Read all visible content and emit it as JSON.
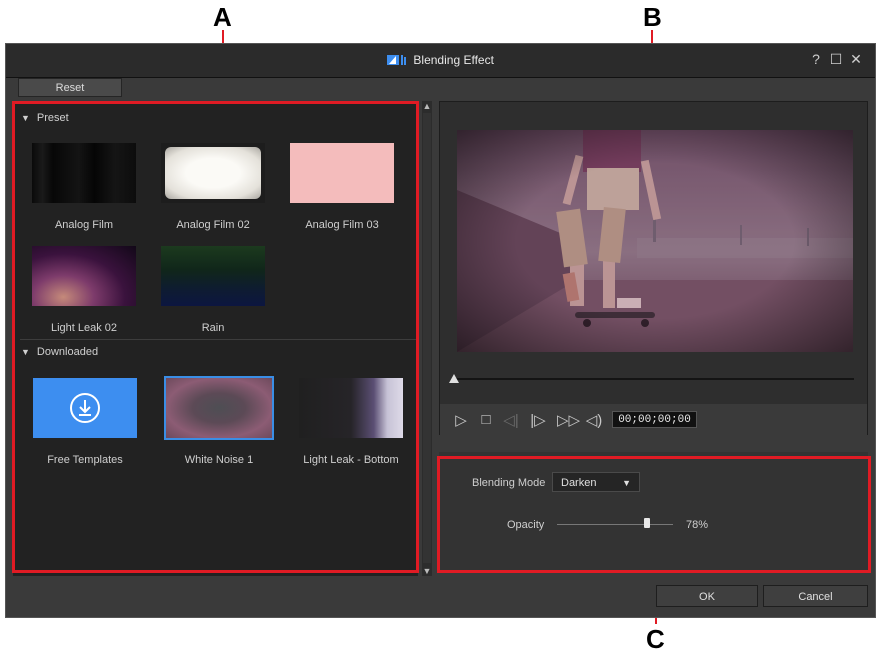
{
  "callouts": {
    "a": "A",
    "b": "B",
    "c": "C"
  },
  "window": {
    "title": "Blending Effect",
    "help": "?",
    "maximize": "☐",
    "close": "✕"
  },
  "toolbar": {
    "reset_label": "Reset"
  },
  "library": {
    "preset_header": "Preset",
    "downloaded_header": "Downloaded",
    "presets": [
      {
        "label": "Analog Film"
      },
      {
        "label": "Analog Film 02"
      },
      {
        "label": "Analog Film 03"
      },
      {
        "label": "Light Leak 02"
      },
      {
        "label": "Rain"
      }
    ],
    "downloaded": [
      {
        "label": "Free Templates"
      },
      {
        "label": "White Noise 1",
        "selected": true
      },
      {
        "label": "Light Leak - Bottom"
      }
    ]
  },
  "player": {
    "timecode": "00;00;00;00",
    "seek_position": 0,
    "icons": [
      "play-icon",
      "stop-icon",
      "previous-frame-icon",
      "next-frame-icon",
      "fast-forward-icon",
      "volume-icon"
    ]
  },
  "settings": {
    "blending_mode_label": "Blending Mode",
    "blending_mode_value": "Darken",
    "opacity_label": "Opacity",
    "opacity_value": "78%",
    "opacity_fraction": 0.78
  },
  "footer": {
    "ok_label": "OK",
    "cancel_label": "Cancel"
  },
  "colors": {
    "callout_red": "#e01b24",
    "selection_blue": "#3a8ee6",
    "template_blue": "#3d8ef0"
  }
}
